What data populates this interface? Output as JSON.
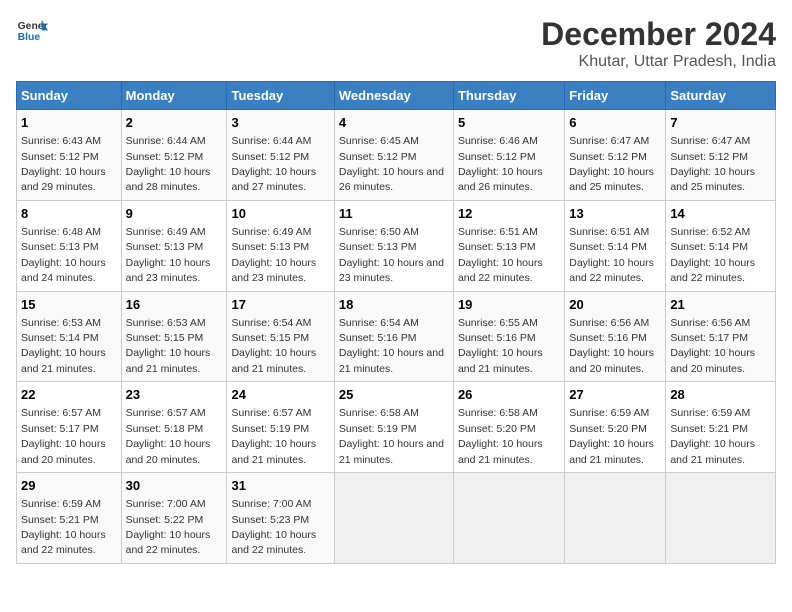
{
  "logo": {
    "text_general": "General",
    "text_blue": "Blue"
  },
  "title": "December 2024",
  "subtitle": "Khutar, Uttar Pradesh, India",
  "days_of_week": [
    "Sunday",
    "Monday",
    "Tuesday",
    "Wednesday",
    "Thursday",
    "Friday",
    "Saturday"
  ],
  "weeks": [
    [
      {
        "day": "1",
        "sunrise": "6:43 AM",
        "sunset": "5:12 PM",
        "daylight": "10 hours and 29 minutes."
      },
      {
        "day": "2",
        "sunrise": "6:44 AM",
        "sunset": "5:12 PM",
        "daylight": "10 hours and 28 minutes."
      },
      {
        "day": "3",
        "sunrise": "6:44 AM",
        "sunset": "5:12 PM",
        "daylight": "10 hours and 27 minutes."
      },
      {
        "day": "4",
        "sunrise": "6:45 AM",
        "sunset": "5:12 PM",
        "daylight": "10 hours and 26 minutes."
      },
      {
        "day": "5",
        "sunrise": "6:46 AM",
        "sunset": "5:12 PM",
        "daylight": "10 hours and 26 minutes."
      },
      {
        "day": "6",
        "sunrise": "6:47 AM",
        "sunset": "5:12 PM",
        "daylight": "10 hours and 25 minutes."
      },
      {
        "day": "7",
        "sunrise": "6:47 AM",
        "sunset": "5:12 PM",
        "daylight": "10 hours and 25 minutes."
      }
    ],
    [
      {
        "day": "8",
        "sunrise": "6:48 AM",
        "sunset": "5:13 PM",
        "daylight": "10 hours and 24 minutes."
      },
      {
        "day": "9",
        "sunrise": "6:49 AM",
        "sunset": "5:13 PM",
        "daylight": "10 hours and 23 minutes."
      },
      {
        "day": "10",
        "sunrise": "6:49 AM",
        "sunset": "5:13 PM",
        "daylight": "10 hours and 23 minutes."
      },
      {
        "day": "11",
        "sunrise": "6:50 AM",
        "sunset": "5:13 PM",
        "daylight": "10 hours and 23 minutes."
      },
      {
        "day": "12",
        "sunrise": "6:51 AM",
        "sunset": "5:13 PM",
        "daylight": "10 hours and 22 minutes."
      },
      {
        "day": "13",
        "sunrise": "6:51 AM",
        "sunset": "5:14 PM",
        "daylight": "10 hours and 22 minutes."
      },
      {
        "day": "14",
        "sunrise": "6:52 AM",
        "sunset": "5:14 PM",
        "daylight": "10 hours and 22 minutes."
      }
    ],
    [
      {
        "day": "15",
        "sunrise": "6:53 AM",
        "sunset": "5:14 PM",
        "daylight": "10 hours and 21 minutes."
      },
      {
        "day": "16",
        "sunrise": "6:53 AM",
        "sunset": "5:15 PM",
        "daylight": "10 hours and 21 minutes."
      },
      {
        "day": "17",
        "sunrise": "6:54 AM",
        "sunset": "5:15 PM",
        "daylight": "10 hours and 21 minutes."
      },
      {
        "day": "18",
        "sunrise": "6:54 AM",
        "sunset": "5:16 PM",
        "daylight": "10 hours and 21 minutes."
      },
      {
        "day": "19",
        "sunrise": "6:55 AM",
        "sunset": "5:16 PM",
        "daylight": "10 hours and 21 minutes."
      },
      {
        "day": "20",
        "sunrise": "6:56 AM",
        "sunset": "5:16 PM",
        "daylight": "10 hours and 20 minutes."
      },
      {
        "day": "21",
        "sunrise": "6:56 AM",
        "sunset": "5:17 PM",
        "daylight": "10 hours and 20 minutes."
      }
    ],
    [
      {
        "day": "22",
        "sunrise": "6:57 AM",
        "sunset": "5:17 PM",
        "daylight": "10 hours and 20 minutes."
      },
      {
        "day": "23",
        "sunrise": "6:57 AM",
        "sunset": "5:18 PM",
        "daylight": "10 hours and 20 minutes."
      },
      {
        "day": "24",
        "sunrise": "6:57 AM",
        "sunset": "5:19 PM",
        "daylight": "10 hours and 21 minutes."
      },
      {
        "day": "25",
        "sunrise": "6:58 AM",
        "sunset": "5:19 PM",
        "daylight": "10 hours and 21 minutes."
      },
      {
        "day": "26",
        "sunrise": "6:58 AM",
        "sunset": "5:20 PM",
        "daylight": "10 hours and 21 minutes."
      },
      {
        "day": "27",
        "sunrise": "6:59 AM",
        "sunset": "5:20 PM",
        "daylight": "10 hours and 21 minutes."
      },
      {
        "day": "28",
        "sunrise": "6:59 AM",
        "sunset": "5:21 PM",
        "daylight": "10 hours and 21 minutes."
      }
    ],
    [
      {
        "day": "29",
        "sunrise": "6:59 AM",
        "sunset": "5:21 PM",
        "daylight": "10 hours and 22 minutes."
      },
      {
        "day": "30",
        "sunrise": "7:00 AM",
        "sunset": "5:22 PM",
        "daylight": "10 hours and 22 minutes."
      },
      {
        "day": "31",
        "sunrise": "7:00 AM",
        "sunset": "5:23 PM",
        "daylight": "10 hours and 22 minutes."
      },
      null,
      null,
      null,
      null
    ]
  ]
}
